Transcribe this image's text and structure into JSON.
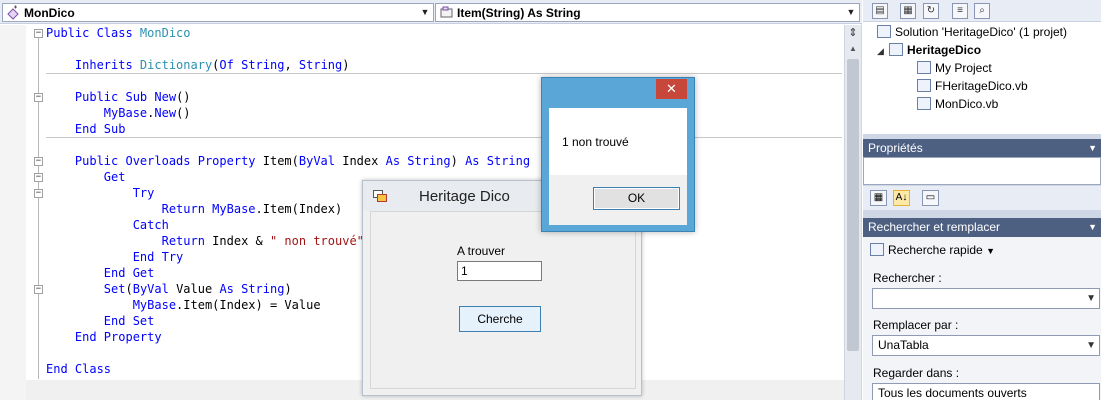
{
  "editor": {
    "class_combo": "MonDico",
    "member_combo": "Item(String) As String",
    "code": [
      [
        {
          "t": "Public Class ",
          "c": "kw"
        },
        {
          "t": "MonDico",
          "c": "ty"
        }
      ],
      [],
      [
        {
          "t": "    Inherits ",
          "c": "kw"
        },
        {
          "t": "Dictionary",
          "c": "ty"
        },
        {
          "t": "(",
          "c": ""
        },
        {
          "t": "Of ",
          "c": "kw"
        },
        {
          "t": "String",
          "c": "kw"
        },
        {
          "t": ", ",
          "c": ""
        },
        {
          "t": "String",
          "c": "kw"
        },
        {
          "t": ")",
          "c": ""
        }
      ],
      [],
      [
        {
          "t": "    Public Sub ",
          "c": "kw"
        },
        {
          "t": "New",
          "c": "kw"
        },
        {
          "t": "()",
          "c": ""
        }
      ],
      [
        {
          "t": "        MyBase",
          "c": "kw"
        },
        {
          "t": ".",
          "c": ""
        },
        {
          "t": "New",
          "c": "kw"
        },
        {
          "t": "()",
          "c": ""
        }
      ],
      [
        {
          "t": "    End Sub",
          "c": "kw"
        }
      ],
      [],
      [
        {
          "t": "    Public Overloads Property ",
          "c": "kw"
        },
        {
          "t": "Item(",
          "c": ""
        },
        {
          "t": "ByVal ",
          "c": "kw"
        },
        {
          "t": "Index ",
          "c": ""
        },
        {
          "t": "As String",
          "c": "kw"
        },
        {
          "t": ") ",
          "c": ""
        },
        {
          "t": "As String",
          "c": "kw"
        }
      ],
      [
        {
          "t": "        Get",
          "c": "kw"
        }
      ],
      [
        {
          "t": "            Try",
          "c": "kw"
        }
      ],
      [
        {
          "t": "                Return ",
          "c": "kw"
        },
        {
          "t": "MyBase",
          "c": "kw"
        },
        {
          "t": ".Item(Index)",
          "c": ""
        }
      ],
      [
        {
          "t": "            Catch",
          "c": "kw"
        }
      ],
      [
        {
          "t": "                Return ",
          "c": "kw"
        },
        {
          "t": "Index & ",
          "c": ""
        },
        {
          "t": "\" non trouvé\"",
          "c": "st"
        }
      ],
      [
        {
          "t": "            End Try",
          "c": "kw"
        }
      ],
      [
        {
          "t": "        End Get",
          "c": "kw"
        }
      ],
      [
        {
          "t": "        Set",
          "c": "kw"
        },
        {
          "t": "(",
          "c": ""
        },
        {
          "t": "ByVal ",
          "c": "kw"
        },
        {
          "t": "Value ",
          "c": ""
        },
        {
          "t": "As String",
          "c": "kw"
        },
        {
          "t": ")",
          "c": ""
        }
      ],
      [
        {
          "t": "            MyBase",
          "c": "kw"
        },
        {
          "t": ".Item(Index) = Value",
          "c": ""
        }
      ],
      [
        {
          "t": "        End Set",
          "c": "kw"
        }
      ],
      [
        {
          "t": "    End Property",
          "c": "kw"
        }
      ],
      [],
      [
        {
          "t": "End Class",
          "c": "kw"
        }
      ]
    ]
  },
  "solution_explorer": {
    "solution": "Solution 'HeritageDico' (1 projet)",
    "project": "HeritageDico",
    "items": [
      "My Project",
      "FHeritageDico.vb",
      "MonDico.vb"
    ]
  },
  "properties": {
    "header": "Propriétés"
  },
  "find_replace": {
    "header": "Rechercher et remplacer",
    "mode": "Recherche rapide",
    "find_label": "Rechercher :",
    "find_value": "",
    "replace_label": "Remplacer par :",
    "replace_value": "UnaTabla",
    "look_in_label": "Regarder dans :",
    "look_in_value": "Tous les documents ouverts"
  },
  "heritage_window": {
    "title": "Heritage Dico",
    "label": "A trouver",
    "input_value": "1",
    "button": "Cherche"
  },
  "message_box": {
    "close": "✕",
    "message": "1 non trouvé",
    "ok": "OK"
  },
  "colors": {
    "keyword": "#0000ff",
    "type": "#2b91af",
    "string": "#a31515",
    "panel_header": "#4d6082",
    "message_frame": "#5aa6d6",
    "close_button": "#c7483a"
  }
}
